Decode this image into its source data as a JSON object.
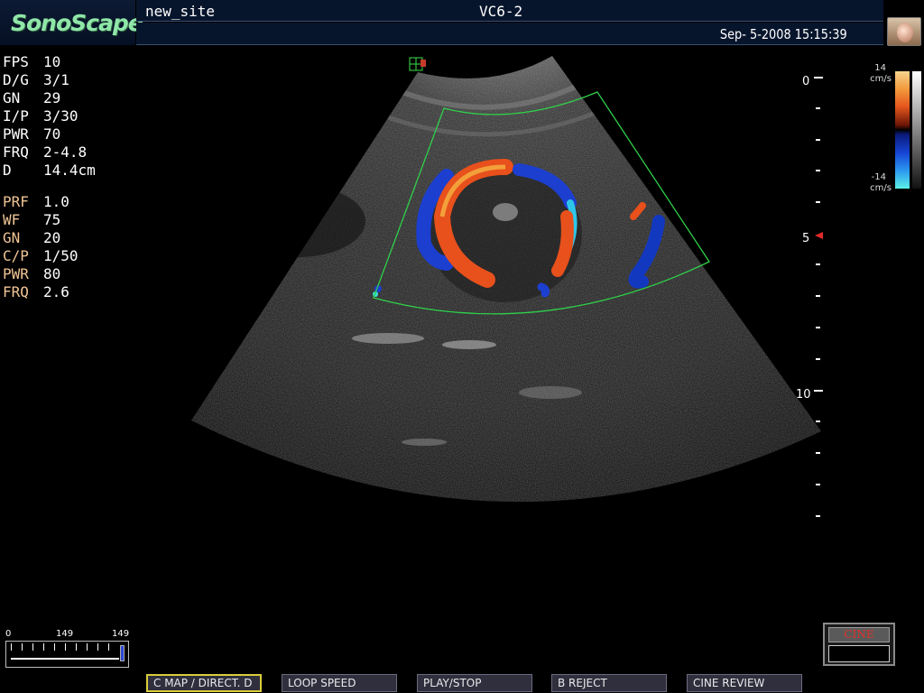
{
  "header": {
    "logo": "SonoScape",
    "site": "new_site",
    "probe": "VC6-2",
    "datetime": "Sep- 5-2008 15:15:39"
  },
  "bmode_params": [
    {
      "label": "FPS",
      "value": "10"
    },
    {
      "label": "D/G",
      "value": "3/1"
    },
    {
      "label": "GN",
      "value": "29"
    },
    {
      "label": "I/P",
      "value": "3/30"
    },
    {
      "label": "PWR",
      "value": "70"
    },
    {
      "label": "FRQ",
      "value": "2-4.8"
    },
    {
      "label": "D",
      "value": "14.4cm"
    }
  ],
  "color_params": [
    {
      "label": "PRF",
      "value": "1.0"
    },
    {
      "label": "WF",
      "value": "75"
    },
    {
      "label": "GN",
      "value": "20"
    },
    {
      "label": "C/P",
      "value": "1/50"
    },
    {
      "label": "PWR",
      "value": "80"
    },
    {
      "label": "FRQ",
      "value": "2.6"
    }
  ],
  "depth_scale": {
    "labels": [
      "0",
      "5",
      "10"
    ]
  },
  "color_bar": {
    "top_value": "14",
    "top_unit": "cm/s",
    "bottom_value": "-14",
    "bottom_unit": "cm/s",
    "colors": {
      "positive": "#e5561e",
      "negative": "#1746d6"
    }
  },
  "cine_slider": {
    "min": "0",
    "current": "149",
    "max": "149"
  },
  "cine_box": {
    "label": "CINE"
  },
  "softkeys": [
    {
      "label": "C MAP / DIRECT. D",
      "active": true
    },
    {
      "label": "LOOP SPEED",
      "active": false
    },
    {
      "label": "PLAY/STOP",
      "active": false
    },
    {
      "label": "B REJECT",
      "active": false
    },
    {
      "label": "CINE REVIEW",
      "active": false
    }
  ],
  "colors": {
    "logo": "#8fe6a8",
    "color_param_label": "#f0c596",
    "roi_box": "#2fd14a",
    "active_softkey_border": "#d9cd3a"
  }
}
